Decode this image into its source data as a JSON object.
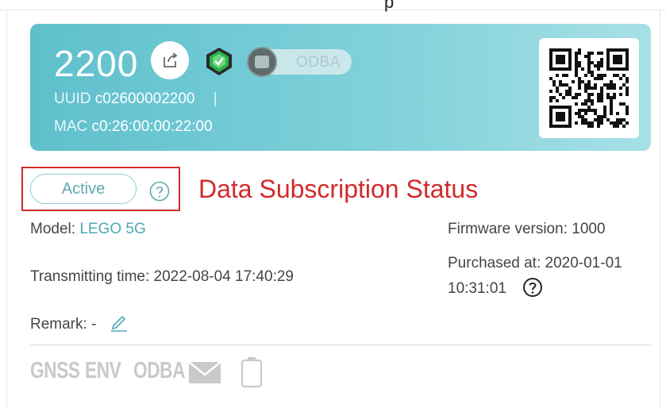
{
  "header": {
    "partial_text": "p"
  },
  "device": {
    "id": "2200",
    "uuid_label": "UUID",
    "uuid": "c02600002200",
    "uuid_sep": "|",
    "mac_label": "MAC",
    "mac": "c0:26:00:00:22:00",
    "odba_toggle_label": "ODBA"
  },
  "status": {
    "badge": "Active",
    "annotation": "Data Subscription Status"
  },
  "details": {
    "model_label": "Model:",
    "model_value": "LEGO 5G",
    "firmware": "Firmware version: 1000",
    "transmitting": "Transmitting time: 2022-08-04 17:40:29",
    "purchased_line1": "Purchased at: 2020-01-01",
    "purchased_line2": "10:31:01",
    "remark": "Remark: -"
  },
  "features": [
    "GNSS",
    "ENV",
    "ODBA"
  ],
  "icons": [
    "share-icon",
    "shield-check-icon",
    "qr-code-icon",
    "help-icon",
    "pencil-icon",
    "mail-icon",
    "battery-icon"
  ],
  "colors": {
    "banner": "#7fd0da",
    "accent": "#4ea9b6",
    "annotation": "#d22a2a",
    "shield": "#2bb34a"
  }
}
